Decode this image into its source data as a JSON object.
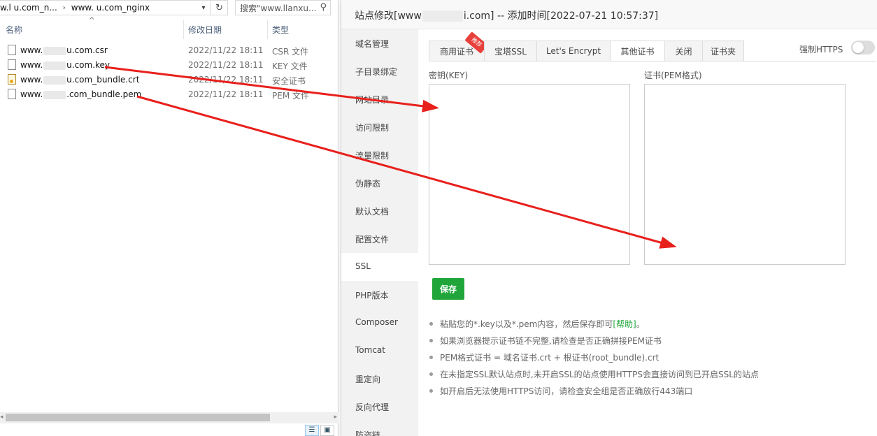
{
  "explorer": {
    "breadcrumb": [
      "w.l  u.com_n...",
      "www.    u.com_nginx"
    ],
    "search_placeholder": "搜索\"www.llanxu...",
    "columns": {
      "name": "名称",
      "modified": "修改日期",
      "type": "类型"
    },
    "files": [
      {
        "name_prefix": "www.",
        "name_suffix": "u.com.csr",
        "date": "2022/11/22 18:11",
        "type": "CSR 文件",
        "icon": "file-icon"
      },
      {
        "name_prefix": "www.",
        "name_suffix": "u.com.key",
        "date": "2022/11/22 18:11",
        "type": "KEY 文件",
        "icon": "file-icon"
      },
      {
        "name_prefix": "www.",
        "name_suffix": "u.com_bundle.crt",
        "date": "2022/11/22 18:11",
        "type": "安全证书",
        "icon": "certificate-icon"
      },
      {
        "name_prefix": "www.",
        "name_suffix": ".com_bundle.pem",
        "date": "2022/11/22 18:11",
        "type": "PEM 文件",
        "icon": "file-icon"
      }
    ]
  },
  "panel": {
    "title_prefix": "站点修改[www",
    "title_suffix": "i.com] -- 添加时间[2022-07-21 10:57:37]",
    "nav": [
      "域名管理",
      "子目录绑定",
      "网站目录",
      "访问限制",
      "流量限制",
      "伪静态",
      "默认文档",
      "配置文件",
      "SSL",
      "PHP版本",
      "Composer",
      "Tomcat",
      "重定向",
      "反向代理",
      "防盗链"
    ],
    "active_nav": "SSL",
    "tabs": [
      "商用证书",
      "宝塔SSL",
      "Let's Encrypt",
      "其他证书",
      "关闭",
      "证书夹"
    ],
    "active_tab": "其他证书",
    "ribbon": "推荐",
    "https_label": "强制HTTPS",
    "https_enabled": false,
    "key_label": "密钥(KEY)",
    "cert_label": "证书(PEM格式)",
    "save_label": "保存",
    "tips": [
      {
        "text": "粘贴您的*.key以及*.pem内容，然后保存即可",
        "link": "[帮助]",
        "tail": "。"
      },
      {
        "text": "如果浏览器提示证书链不完整,请检查是否正确拼接PEM证书",
        "link": "",
        "tail": ""
      },
      {
        "text": "PEM格式证书 = 域名证书.crt + 根证书(root_bundle).crt",
        "link": "",
        "tail": ""
      },
      {
        "text": "在未指定SSL默认站点时,未开启SSL的站点使用HTTPS会直接访问到已开启SSL的站点",
        "link": "",
        "tail": ""
      },
      {
        "text": "如开启后无法使用HTTPS访问，请检查安全组是否正确放行443端口",
        "link": "",
        "tail": ""
      }
    ],
    "accent_color": "#20a53a",
    "arrow_color": "#e8201c"
  }
}
